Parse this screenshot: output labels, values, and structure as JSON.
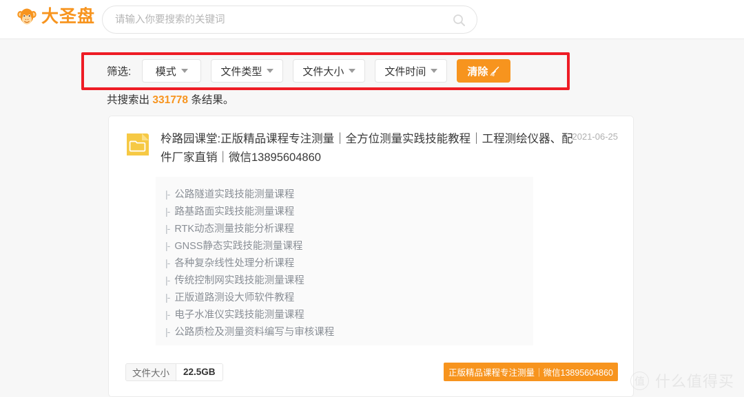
{
  "header": {
    "logo_text": "大圣盘",
    "logo_icon": "monkey-face-icon",
    "search": {
      "placeholder": "请输入你要搜索的关键词",
      "value": "",
      "icon": "search-icon"
    }
  },
  "filters": {
    "label": "筛选:",
    "dropdowns": [
      {
        "label": "模式"
      },
      {
        "label": "文件类型"
      },
      {
        "label": "文件大小"
      },
      {
        "label": "文件时间"
      }
    ],
    "clear_button": {
      "label": "清除",
      "icon": "broom-icon",
      "color": "#f7941e"
    },
    "annotation_color": "#ee1c25"
  },
  "results": {
    "count_prefix": "共搜索出",
    "count": "331778",
    "count_suffix": "条结果。",
    "count_color": "#f7941e",
    "card": {
      "folder_icon": "folder-icon",
      "title": "柃路园课堂:正版精品课程专注测量｜全方位测量实践技能教程｜工程测绘仪器、配件厂家直销｜微信13895604860",
      "date": "2021-06-25",
      "files": [
        "公路隧道实践技能测量课程",
        "路基路面实践技能测量课程",
        "RTK动态测量技能分析课程",
        "GNSS静态实践技能测量课程",
        "各种复杂线性处理分析课程",
        "传统控制网实践技能测量课程",
        "正版道路测设大师软件教程",
        "电子水准仪实践技能测量课程",
        "公路质检及测量资料编写与审核课程"
      ],
      "file_bullet": "|-",
      "size_label": "文件大小",
      "size_value": "22.5GB",
      "promo_badge": "正版精品课程专注测量｜微信13895604860"
    }
  },
  "watermark": {
    "mark": "值",
    "text": "什么值得买"
  }
}
